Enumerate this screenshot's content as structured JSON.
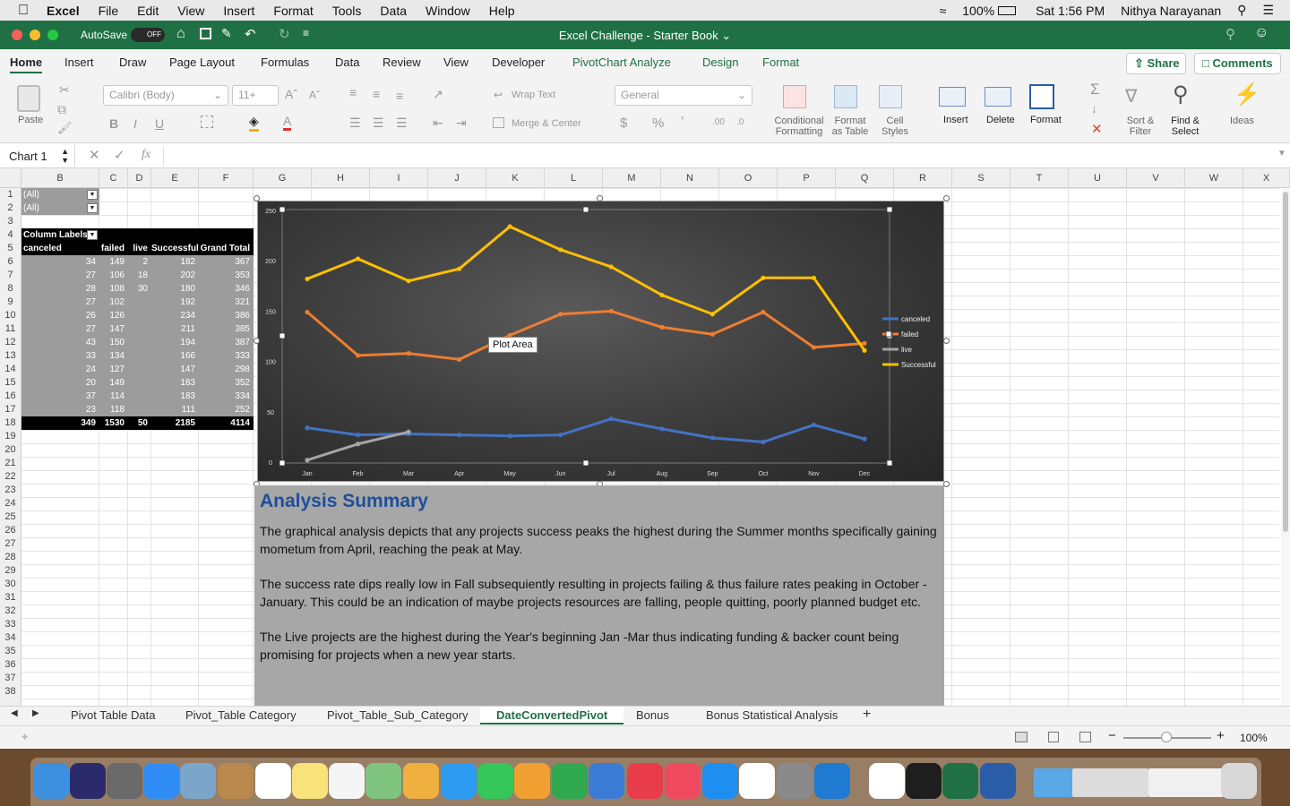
{
  "menubar": {
    "app": "Excel",
    "items": [
      "File",
      "Edit",
      "View",
      "Insert",
      "Format",
      "Tools",
      "Data",
      "Window",
      "Help"
    ],
    "battery": "100%",
    "clock": "Sat 1:56 PM",
    "user": "Nithya Narayanan"
  },
  "titlebar": {
    "autosave": "AutoSave",
    "autosave_state": "OFF",
    "title": "Excel Challenge - Starter Book"
  },
  "ribbon_tabs": [
    "Home",
    "Insert",
    "Draw",
    "Page Layout",
    "Formulas",
    "Data",
    "Review",
    "View",
    "Developer",
    "PivotChart Analyze",
    "Design",
    "Format"
  ],
  "share": "Share",
  "comments": "Comments",
  "ribbon": {
    "paste": "Paste",
    "font": "Calibri (Body)",
    "size": "11+",
    "wrap": "Wrap Text",
    "merge": "Merge & Center",
    "numfmt": "General",
    "cond": "Conditional",
    "cond2": "Formatting",
    "fmt_table": "Format",
    "fmt_table2": "as Table",
    "cell": "Cell",
    "cell2": "Styles",
    "insert": "Insert",
    "delete": "Delete",
    "format": "Format",
    "sort": "Sort &",
    "sort2": "Filter",
    "find": "Find &",
    "find2": "Select",
    "ideas": "Ideas"
  },
  "namebox": "Chart 1",
  "fx": "fx",
  "columns": [
    "B",
    "C",
    "D",
    "E",
    "F",
    "G",
    "H",
    "I",
    "J",
    "K",
    "L",
    "M",
    "N",
    "O",
    "P",
    "Q",
    "R",
    "S",
    "T",
    "U",
    "V",
    "W",
    "X"
  ],
  "rows": [
    "1",
    "2",
    "3",
    "4",
    "5",
    "6",
    "7",
    "8",
    "9",
    "10",
    "11",
    "12",
    "13",
    "14",
    "15",
    "16",
    "17",
    "18",
    "19",
    "20",
    "21",
    "22",
    "23",
    "24",
    "25",
    "26",
    "27",
    "28",
    "29",
    "30",
    "31",
    "32",
    "33",
    "34",
    "35",
    "36",
    "37",
    "38"
  ],
  "pivot": {
    "filters": [
      "(All)",
      "(All)"
    ],
    "col_labels": "Column Labels",
    "headers": [
      "canceled",
      "failed",
      "live",
      "Successful",
      "Grand Total"
    ],
    "data": [
      [
        "34",
        "149",
        "2",
        "182",
        "367"
      ],
      [
        "27",
        "106",
        "18",
        "202",
        "353"
      ],
      [
        "28",
        "108",
        "30",
        "180",
        "346"
      ],
      [
        "27",
        "102",
        "",
        "192",
        "321"
      ],
      [
        "26",
        "126",
        "",
        "234",
        "386"
      ],
      [
        "27",
        "147",
        "",
        "211",
        "385"
      ],
      [
        "43",
        "150",
        "",
        "194",
        "387"
      ],
      [
        "33",
        "134",
        "",
        "166",
        "333"
      ],
      [
        "24",
        "127",
        "",
        "147",
        "298"
      ],
      [
        "20",
        "149",
        "",
        "183",
        "352"
      ],
      [
        "37",
        "114",
        "",
        "183",
        "334"
      ],
      [
        "23",
        "118",
        "",
        "111",
        "252"
      ]
    ],
    "totals": [
      "349",
      "1530",
      "50",
      "2185",
      "4114"
    ]
  },
  "chart_data": {
    "type": "line",
    "categories": [
      "Jan",
      "Feb",
      "Mar",
      "Apr",
      "May",
      "Jun",
      "Jul",
      "Aug",
      "Sep",
      "Oct",
      "Nov",
      "Dec"
    ],
    "series": [
      {
        "name": "canceled",
        "color": "#4472c4",
        "values": [
          34,
          27,
          28,
          27,
          26,
          27,
          43,
          33,
          24,
          20,
          37,
          23
        ]
      },
      {
        "name": "failed",
        "color": "#ed7d31",
        "values": [
          149,
          106,
          108,
          102,
          126,
          147,
          150,
          134,
          127,
          149,
          114,
          118
        ]
      },
      {
        "name": "live",
        "color": "#a5a5a5",
        "values": [
          2,
          18,
          30
        ]
      },
      {
        "name": "Successful",
        "color": "#ffc000",
        "values": [
          182,
          202,
          180,
          192,
          234,
          211,
          194,
          166,
          147,
          183,
          183,
          111
        ]
      }
    ],
    "ylim": [
      0,
      250
    ],
    "yticks": [
      "0",
      "50",
      "100",
      "150",
      "200",
      "250"
    ],
    "tooltip": "Plot Area",
    "legend": "right"
  },
  "summary": {
    "title": "Analysis Summary",
    "p1": "The graphical analysis depicts that any projects success peaks the highest during the Summer months specifically gaining mometum from April, reaching the peak at May.",
    "p2": "The success rate dips really low in Fall subsequiently resulting in projects failing & thus failure rates peaking in October - January. This could be an indication of maybe projects resources are falling, people quitting,  poorly planned budget etc.",
    "p3": "The Live projects are the highest during the Year's beginning Jan -Mar thus indicating funding & backer count being promising for projects when a new year starts."
  },
  "sheet_tabs": [
    "Pivot Table Data",
    "Pivot_Table Category",
    "Pivot_Table_Sub_Category",
    "DateConvertedPivot",
    "Bonus",
    "Bonus Statistical Analysis"
  ],
  "zoom": "100%"
}
